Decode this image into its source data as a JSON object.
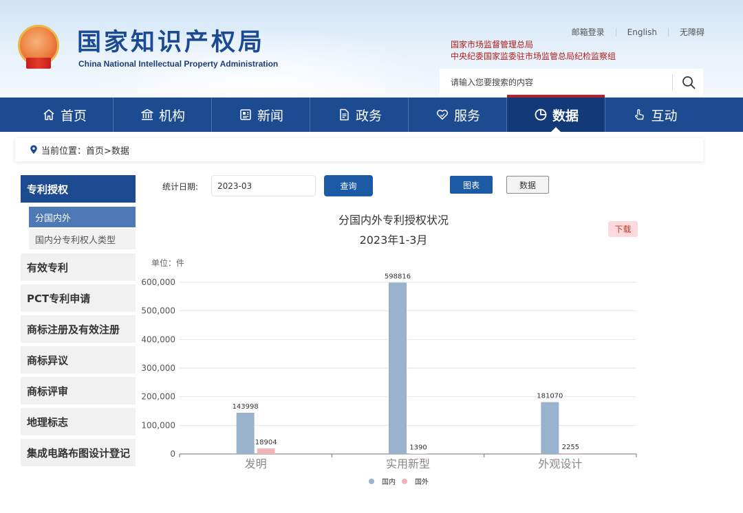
{
  "header": {
    "org_name_cn": "国家知识产权局",
    "org_name_en": "China National Intellectual Property Administration",
    "links": [
      "邮箱登录",
      "English",
      "无障碍"
    ],
    "supervise_line1": "国家市场监督管理总局",
    "supervise_line2": "中央纪委国家监委驻市场监管总局纪检监察组",
    "search_placeholder": "请输入您要搜索的内容"
  },
  "nav": [
    {
      "label": "首页",
      "icon": "home-icon",
      "active": false
    },
    {
      "label": "机构",
      "icon": "institution-icon",
      "active": false
    },
    {
      "label": "新闻",
      "icon": "newspaper-icon",
      "active": false
    },
    {
      "label": "政务",
      "icon": "document-icon",
      "active": false
    },
    {
      "label": "服务",
      "icon": "service-icon",
      "active": false
    },
    {
      "label": "数据",
      "icon": "pie-chart-icon",
      "active": true
    },
    {
      "label": "互动",
      "icon": "hand-pointer-icon",
      "active": false
    }
  ],
  "breadcrumb": "当前位置：首页>数据",
  "sidebar": [
    {
      "label": "专利授权",
      "active": true,
      "children": [
        {
          "label": "分国内外",
          "active": true
        },
        {
          "label": "国内分专利权人类型",
          "active": false
        }
      ]
    },
    {
      "label": "有效专利"
    },
    {
      "label": "PCT专利申请"
    },
    {
      "label": "商标注册及有效注册"
    },
    {
      "label": "商标异议"
    },
    {
      "label": "商标评审"
    },
    {
      "label": "地理标志"
    },
    {
      "label": "集成电路布图设计登记"
    }
  ],
  "controls": {
    "date_label": "统计日期:",
    "date_value": "2023-03",
    "query_label": "查询",
    "chart_label": "图表",
    "data_label": "数据",
    "download_label": "下载"
  },
  "colors": {
    "nav_bg": "#1c4b92",
    "accent_red": "#b32427",
    "series_domestic": "#9ab3cc",
    "series_foreign": "#f0b4b6"
  },
  "chart_data": {
    "type": "bar",
    "title": "分国内外专利授权状况",
    "subtitle": "2023年1-3月",
    "unit_label": "单位：件",
    "categories": [
      "发明",
      "实用新型",
      "外观设计"
    ],
    "series": [
      {
        "name": "国内",
        "values": [
          143998,
          598816,
          181070
        ]
      },
      {
        "name": "国外",
        "values": [
          18904,
          1390,
          2255
        ]
      }
    ],
    "ylim": [
      0,
      600000
    ],
    "yticks": [
      0,
      100000,
      200000,
      300000,
      400000,
      500000,
      600000
    ],
    "ytick_labels": [
      "0",
      "100,000",
      "200,000",
      "300,000",
      "400,000",
      "500,000",
      "600,000"
    ],
    "grid": true,
    "legend_position": "bottom"
  }
}
